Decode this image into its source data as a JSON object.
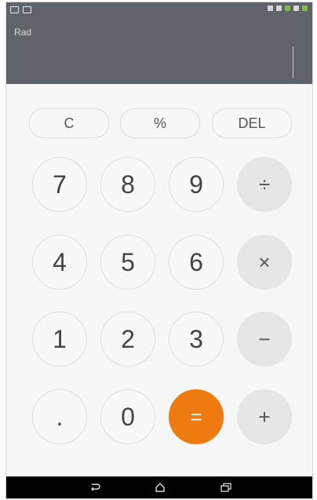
{
  "display": {
    "mode_label": "Rad"
  },
  "functions": [
    {
      "label": "C"
    },
    {
      "label": "%"
    },
    {
      "label": "DEL"
    }
  ],
  "keys": {
    "seven": "7",
    "eight": "8",
    "nine": "9",
    "divide": "÷",
    "four": "4",
    "five": "5",
    "six": "6",
    "multiply": "×",
    "one": "1",
    "two": "2",
    "three": "3",
    "minus": "−",
    "dot": ".",
    "zero": "0",
    "equals": "=",
    "plus": "+"
  },
  "colors": {
    "display_bg": "#60636a",
    "accent": "#ef7a0f"
  },
  "status_icons": [
    "notification-icon",
    "notification-icon",
    "mute-icon",
    "wifi-icon",
    "sim-icon",
    "signal-icon",
    "battery-icon"
  ],
  "nav_icons": [
    "back-icon",
    "home-icon",
    "recent-apps-icon"
  ]
}
